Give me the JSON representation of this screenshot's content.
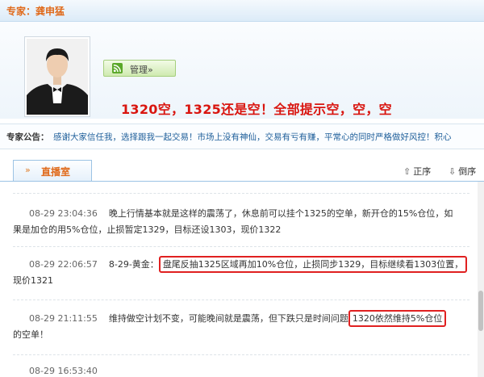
{
  "header": {
    "expert_title": "专家：龚申猛"
  },
  "profile": {
    "manage_label": "管理»",
    "headline": "1320空，1325还是空！全部提示空，空，空"
  },
  "announcement": {
    "label": "专家公告：",
    "text": "感谢大家信任我，选择跟我一起交易！市场上没有神仙，交易有亏有赚，平常心的同时严格做好风控！积心"
  },
  "tabs": {
    "live_label": "直播室",
    "sort_asc": "正序",
    "sort_desc": "倒序"
  },
  "feed": [
    {
      "time": "08-29 23:04:36",
      "line1": "晚上行情基本就是这样的震荡了，休息前可以挂个1325的空单，新开仓的15%仓位，如",
      "line2": "果是加仓的用5%仓位，止损暂定1329，目标还设1303，现价1322"
    },
    {
      "time": "08-29 22:06:57",
      "prefix": "8-29-黄金：",
      "highlight": "盘尾反抽1325区域再加10%仓位，止损同步1329，目标继续看1303位置，",
      "line2": "现价1321"
    },
    {
      "time": "08-29 21:11:55",
      "line1": "维持做空计划不变，可能晚间就是震荡，但下跌只是时间问题",
      "highlight": "1320依然维持5%仓位",
      "line2": "的空单！"
    },
    {
      "time": "08-29 16:53:40"
    }
  ],
  "colors": {
    "accent_orange": "#e06a1b",
    "headline_red": "#d9150f",
    "announce_blue": "#1f5f9a",
    "highlight_border": "#e02020"
  }
}
